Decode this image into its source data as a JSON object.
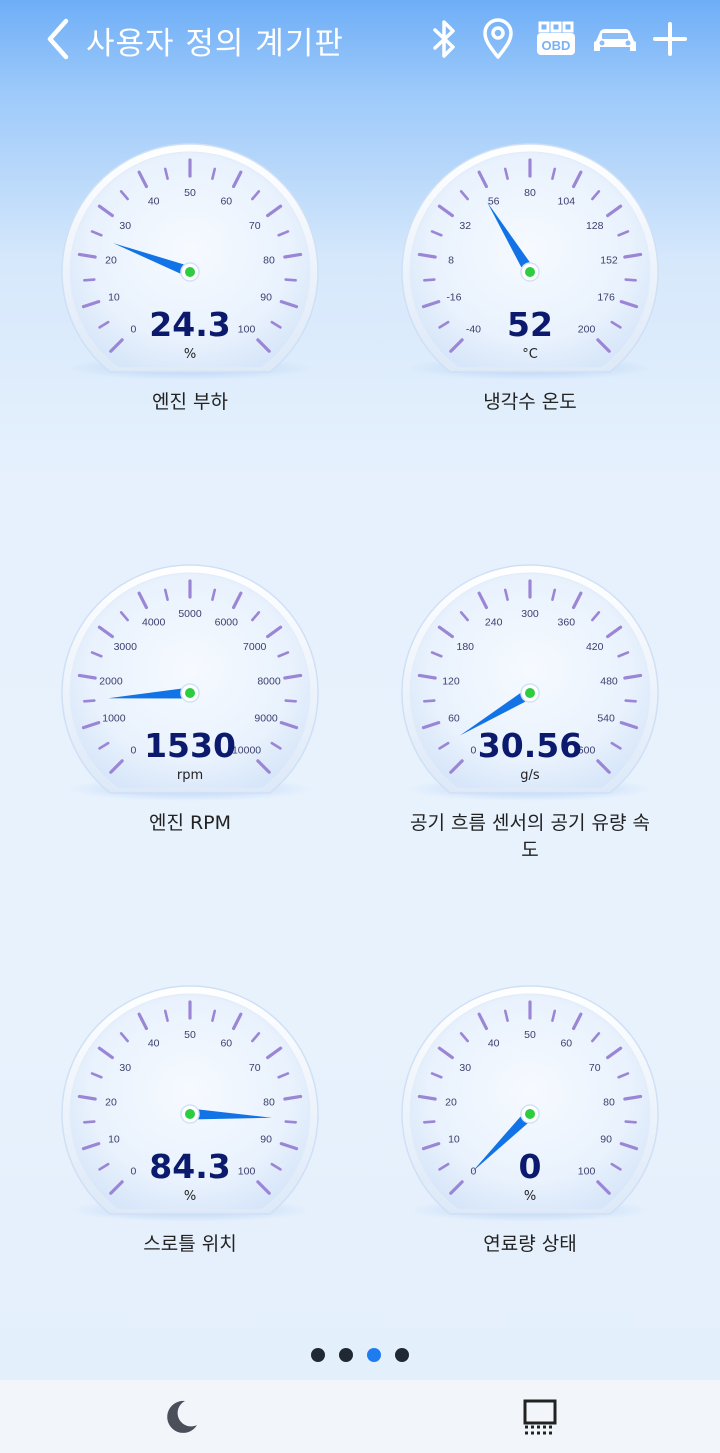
{
  "header": {
    "title": "사용자 정의 계기판",
    "icons": [
      "chevron-left-icon",
      "bluetooth-icon",
      "location-pin-icon",
      "obd-icon",
      "car-icon",
      "plus-icon"
    ],
    "obd_text": "OBD"
  },
  "gauges": [
    {
      "label": "엔진 부하",
      "value": "24.3",
      "unit": "%",
      "ticks": [
        "0",
        "10",
        "20",
        "30",
        "40",
        "50",
        "60",
        "70",
        "80",
        "90",
        "100"
      ],
      "min": 0,
      "max": 100,
      "reading": 24.3
    },
    {
      "label": "냉각수 온도",
      "value": "52",
      "unit": "°C",
      "ticks": [
        "-40",
        "-16",
        "8",
        "32",
        "56",
        "80",
        "104",
        "128",
        "152",
        "176",
        "200"
      ],
      "min": -40,
      "max": 200,
      "reading": 52
    },
    {
      "label": "엔진 RPM",
      "value": "1530",
      "unit": "rpm",
      "ticks": [
        "0",
        "1000",
        "2000",
        "3000",
        "4000",
        "5000",
        "6000",
        "7000",
        "8000",
        "9000",
        "10000"
      ],
      "min": 0,
      "max": 10000,
      "reading": 1530
    },
    {
      "label": "공기 흐름 센서의 공기 유량 속\n도",
      "label_line1": "공기 흐름 센서의 공기 유량 속",
      "label_line2": "도",
      "value": "30.56",
      "unit": "g/s",
      "ticks": [
        "0",
        "60",
        "120",
        "180",
        "240",
        "300",
        "360",
        "420",
        "480",
        "540",
        "600"
      ],
      "min": 0,
      "max": 600,
      "reading": 30.56
    },
    {
      "label": "스로틀 위치",
      "value": "84.3",
      "unit": "%",
      "ticks": [
        "0",
        "10",
        "20",
        "30",
        "40",
        "50",
        "60",
        "70",
        "80",
        "90",
        "100"
      ],
      "min": 0,
      "max": 100,
      "reading": 84.3
    },
    {
      "label": "연료량 상태",
      "value": "0",
      "unit": "%",
      "ticks": [
        "0",
        "10",
        "20",
        "30",
        "40",
        "50",
        "60",
        "70",
        "80",
        "90",
        "100"
      ],
      "min": 0,
      "max": 100,
      "reading": 0
    }
  ],
  "pager": {
    "count": 4,
    "active_index": 2
  },
  "bottom_bar": {
    "icons": [
      "night-mode-icon",
      "layout-screen-icon"
    ]
  },
  "colors": {
    "needle": "#1273e6",
    "hub": "#2ecc40",
    "value_text": "#0c1a6e",
    "tick": "#9b86d6",
    "pager_active": "#1e7cf0"
  }
}
